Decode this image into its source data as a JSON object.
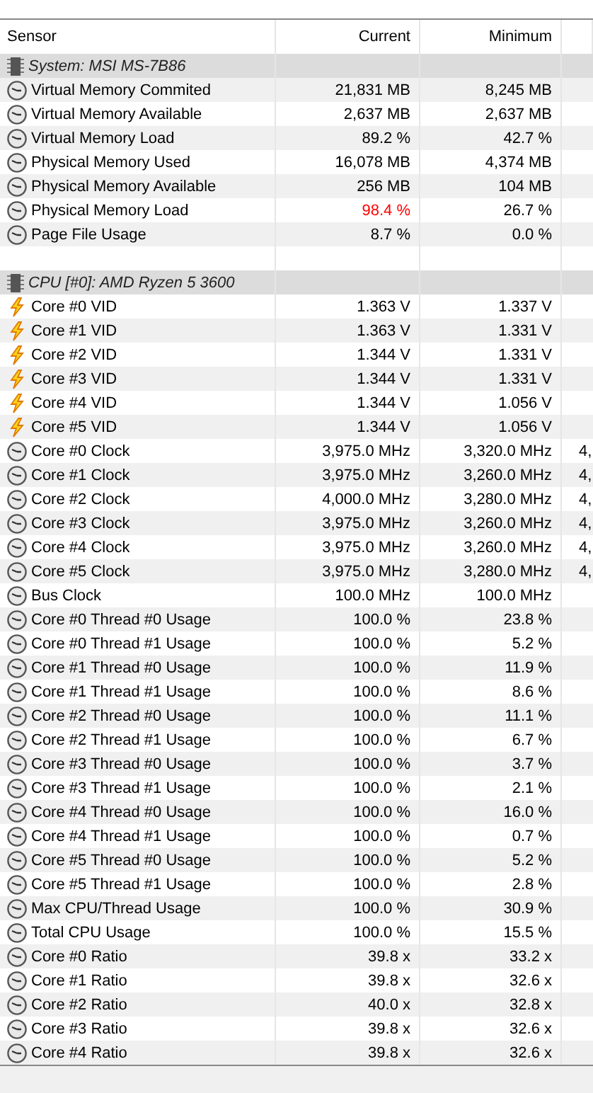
{
  "table": {
    "columns": [
      "Sensor",
      "Current",
      "Minimum"
    ],
    "rows": [
      {
        "kind": "group",
        "label": "System: MSI MS-7B86"
      },
      {
        "kind": "gauge",
        "label": "Virtual Memory Commited",
        "current": "21,831 MB",
        "minimum": "8,245 MB",
        "alert": false
      },
      {
        "kind": "gauge",
        "label": "Virtual Memory Available",
        "current": "2,637 MB",
        "minimum": "2,637 MB",
        "alert": false
      },
      {
        "kind": "gauge",
        "label": "Virtual Memory Load",
        "current": "89.2 %",
        "minimum": "42.7 %",
        "alert": false
      },
      {
        "kind": "gauge",
        "label": "Physical Memory Used",
        "current": "16,078 MB",
        "minimum": "4,374 MB",
        "alert": false
      },
      {
        "kind": "gauge",
        "label": "Physical Memory Available",
        "current": "256 MB",
        "minimum": "104 MB",
        "alert": false
      },
      {
        "kind": "gauge",
        "label": "Physical Memory Load",
        "current": "98.4 %",
        "minimum": "26.7 %",
        "alert": true
      },
      {
        "kind": "gauge",
        "label": "Page File Usage",
        "current": "8.7 %",
        "minimum": "0.0 %",
        "alert": false
      },
      {
        "kind": "blank"
      },
      {
        "kind": "group",
        "label": "CPU [#0]: AMD Ryzen 5 3600"
      },
      {
        "kind": "voltage",
        "label": "Core #0 VID",
        "current": "1.363 V",
        "minimum": "1.337 V",
        "alert": false
      },
      {
        "kind": "voltage",
        "label": "Core #1 VID",
        "current": "1.363 V",
        "minimum": "1.331 V",
        "alert": false
      },
      {
        "kind": "voltage",
        "label": "Core #2 VID",
        "current": "1.344 V",
        "minimum": "1.331 V",
        "alert": false
      },
      {
        "kind": "voltage",
        "label": "Core #3 VID",
        "current": "1.344 V",
        "minimum": "1.331 V",
        "alert": false
      },
      {
        "kind": "voltage",
        "label": "Core #4 VID",
        "current": "1.344 V",
        "minimum": "1.056 V",
        "alert": false
      },
      {
        "kind": "voltage",
        "label": "Core #5 VID",
        "current": "1.344 V",
        "minimum": "1.056 V",
        "alert": false
      },
      {
        "kind": "gauge",
        "label": "Core #0 Clock",
        "current": "3,975.0 MHz",
        "minimum": "3,320.0 MHz",
        "column_4": "4,",
        "alert": false
      },
      {
        "kind": "gauge",
        "label": "Core #1 Clock",
        "current": "3,975.0 MHz",
        "minimum": "3,260.0 MHz",
        "column_4": "4,",
        "alert": false
      },
      {
        "kind": "gauge",
        "label": "Core #2 Clock",
        "current": "4,000.0 MHz",
        "minimum": "3,280.0 MHz",
        "column_4": "4,",
        "alert": false
      },
      {
        "kind": "gauge",
        "label": "Core #3 Clock",
        "current": "3,975.0 MHz",
        "minimum": "3,260.0 MHz",
        "column_4": "4,",
        "alert": false
      },
      {
        "kind": "gauge",
        "label": "Core #4 Clock",
        "current": "3,975.0 MHz",
        "minimum": "3,260.0 MHz",
        "column_4": "4,",
        "alert": false
      },
      {
        "kind": "gauge",
        "label": "Core #5 Clock",
        "current": "3,975.0 MHz",
        "minimum": "3,280.0 MHz",
        "column_4": "4,",
        "alert": false
      },
      {
        "kind": "gauge",
        "label": "Bus Clock",
        "current": "100.0 MHz",
        "minimum": "100.0 MHz",
        "alert": false
      },
      {
        "kind": "gauge",
        "label": "Core #0 Thread #0 Usage",
        "current": "100.0 %",
        "minimum": "23.8 %",
        "alert": false
      },
      {
        "kind": "gauge",
        "label": "Core #0 Thread #1 Usage",
        "current": "100.0 %",
        "minimum": "5.2 %",
        "alert": false
      },
      {
        "kind": "gauge",
        "label": "Core #1 Thread #0 Usage",
        "current": "100.0 %",
        "minimum": "11.9 %",
        "alert": false
      },
      {
        "kind": "gauge",
        "label": "Core #1 Thread #1 Usage",
        "current": "100.0 %",
        "minimum": "8.6 %",
        "alert": false
      },
      {
        "kind": "gauge",
        "label": "Core #2 Thread #0 Usage",
        "current": "100.0 %",
        "minimum": "11.1 %",
        "alert": false
      },
      {
        "kind": "gauge",
        "label": "Core #2 Thread #1 Usage",
        "current": "100.0 %",
        "minimum": "6.7 %",
        "alert": false
      },
      {
        "kind": "gauge",
        "label": "Core #3 Thread #0 Usage",
        "current": "100.0 %",
        "minimum": "3.7 %",
        "alert": false
      },
      {
        "kind": "gauge",
        "label": "Core #3 Thread #1 Usage",
        "current": "100.0 %",
        "minimum": "2.1 %",
        "alert": false
      },
      {
        "kind": "gauge",
        "label": "Core #4 Thread #0 Usage",
        "current": "100.0 %",
        "minimum": "16.0 %",
        "alert": false
      },
      {
        "kind": "gauge",
        "label": "Core #4 Thread #1 Usage",
        "current": "100.0 %",
        "minimum": "0.7 %",
        "alert": false
      },
      {
        "kind": "gauge",
        "label": "Core #5 Thread #0 Usage",
        "current": "100.0 %",
        "minimum": "5.2 %",
        "alert": false
      },
      {
        "kind": "gauge",
        "label": "Core #5 Thread #1 Usage",
        "current": "100.0 %",
        "minimum": "2.8 %",
        "alert": false
      },
      {
        "kind": "gauge",
        "label": "Max CPU/Thread Usage",
        "current": "100.0 %",
        "minimum": "30.9 %",
        "alert": false
      },
      {
        "kind": "gauge",
        "label": "Total CPU Usage",
        "current": "100.0 %",
        "minimum": "15.5 %",
        "alert": false
      },
      {
        "kind": "gauge",
        "label": "Core #0 Ratio",
        "current": "39.8 x",
        "minimum": "33.2 x",
        "alert": false
      },
      {
        "kind": "gauge",
        "label": "Core #1 Ratio",
        "current": "39.8 x",
        "minimum": "32.6 x",
        "alert": false
      },
      {
        "kind": "gauge",
        "label": "Core #2 Ratio",
        "current": "40.0 x",
        "minimum": "32.8 x",
        "alert": false
      },
      {
        "kind": "gauge",
        "label": "Core #3 Ratio",
        "current": "39.8 x",
        "minimum": "32.6 x",
        "alert": false
      },
      {
        "kind": "gauge",
        "label": "Core #4 Ratio",
        "current": "39.8 x",
        "minimum": "32.6 x",
        "alert": false
      }
    ]
  }
}
